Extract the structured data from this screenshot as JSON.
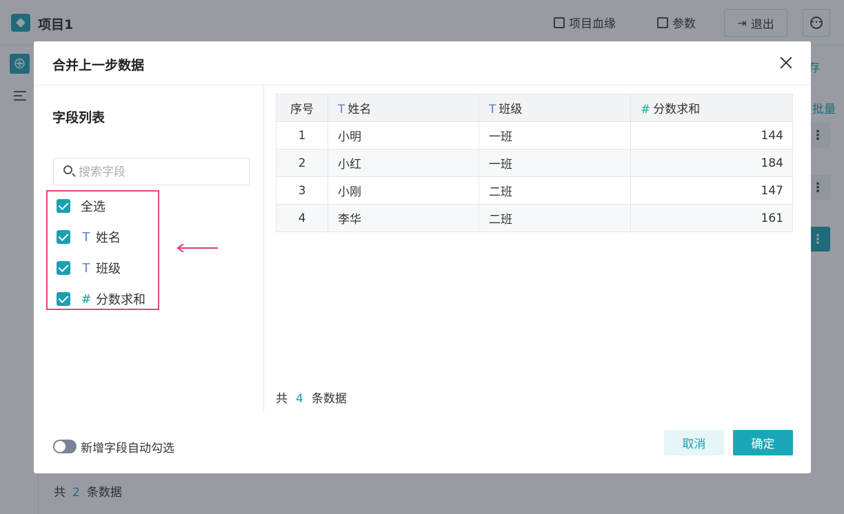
{
  "app": {
    "project_title": "项目1",
    "top_actions": {
      "lineage": "项目血缘",
      "params": "参数",
      "exit": "退出"
    },
    "right_fragments": {
      "save": "存",
      "batch": "批量"
    },
    "footer": {
      "prefix": "共",
      "count": "2",
      "suffix": "条数据"
    }
  },
  "modal": {
    "title": "合并上一步数据",
    "left": {
      "heading": "字段列表",
      "search_placeholder": "搜索字段",
      "select_all": "全选",
      "fields": [
        {
          "label": "姓名",
          "type_icon": "T",
          "checked": true
        },
        {
          "label": "班级",
          "type_icon": "T",
          "checked": true
        },
        {
          "label": "分数求和",
          "type_icon": "#",
          "checked": true
        }
      ],
      "auto_select_label": "新增字段自动勾选",
      "auto_select_on": false
    },
    "table": {
      "headers": [
        "序号",
        "姓名",
        "班级",
        "分数求和"
      ],
      "header_icons": [
        "",
        "T",
        "T",
        "#"
      ],
      "rows": [
        [
          "1",
          "小明",
          "一班",
          "144"
        ],
        [
          "2",
          "小红",
          "一班",
          "184"
        ],
        [
          "3",
          "小刚",
          "二班",
          "147"
        ],
        [
          "4",
          "李华",
          "二班",
          "161"
        ]
      ]
    },
    "count": {
      "prefix": "共",
      "value": "4",
      "suffix": "条数据"
    },
    "buttons": {
      "cancel": "取消",
      "ok": "确定"
    }
  },
  "colors": {
    "accent": "#1a9fb3",
    "highlight": "#e0457b",
    "text_type": "#5b7fc7",
    "number_type": "#1aa89a"
  }
}
